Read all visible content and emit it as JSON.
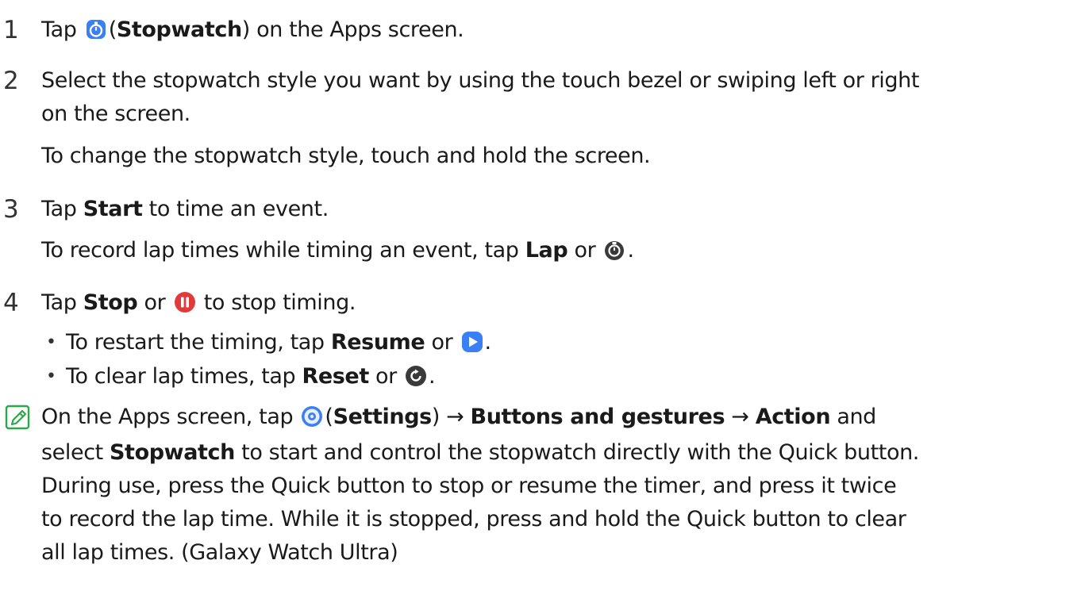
{
  "steps": [
    {
      "number": "1",
      "parts": [
        "Tap ",
        "(",
        "Stopwatch",
        ") on the Apps screen."
      ]
    },
    {
      "number": "2",
      "line1": "Select the stopwatch style you want by using the touch bezel or swiping left or right",
      "line2": "on the screen.",
      "line3": "To change the stopwatch style, touch and hold the screen."
    },
    {
      "number": "3",
      "l1_a": "Tap ",
      "l1_b": "Start",
      "l1_c": " to time an event.",
      "l2_a": "To record lap times while timing an event, tap ",
      "l2_b": "Lap",
      "l2_c": " or ",
      "l2_d": "."
    },
    {
      "number": "4",
      "l1_a": "Tap ",
      "l1_b": "Stop",
      "l1_c": " or ",
      "l1_d": " to stop timing.",
      "bullets": [
        {
          "a": "To restart the timing, tap ",
          "b": "Resume",
          "c": " or ",
          "d": "."
        },
        {
          "a": "To clear lap times, tap ",
          "b": "Reset",
          "c": " or ",
          "d": "."
        }
      ]
    }
  ],
  "note": {
    "l1_a": "On the Apps screen, tap ",
    "l1_b": "(",
    "l1_c": "Settings",
    "l1_d": ") → ",
    "l1_e": "Buttons and gestures",
    "l1_f": " → ",
    "l1_g": "Action",
    "l1_h": " and",
    "l2_a": "select ",
    "l2_b": "Stopwatch",
    "l2_c": " to start and control the stopwatch directly with the Quick button.",
    "l3": "During use, press the Quick button to stop or resume the timer, and press it twice",
    "l4": "to record the lap time. While it is stopped, press and hold the Quick button to clear",
    "l5": "all lap times. (Galaxy Watch Ultra)"
  },
  "colors": {
    "stopwatch_icon": "#3b7ff5",
    "pause_icon": "#e23a3a",
    "play_icon": "#3b7ff5",
    "dark_icon": "#3a3a3a",
    "note_icon": "#2aa84a"
  }
}
